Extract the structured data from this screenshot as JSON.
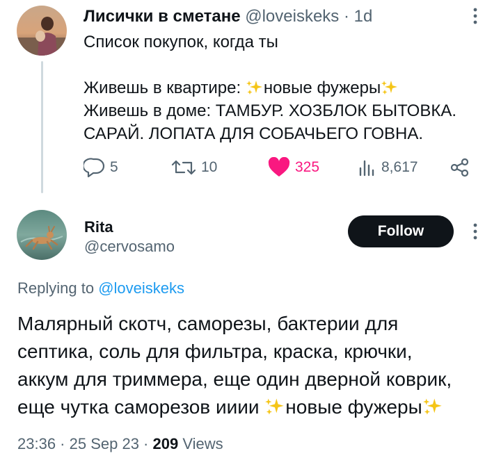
{
  "parent_tweet": {
    "author_name": "Лисички в сметане",
    "handle": "@loveiskeks",
    "separator": "·",
    "time": "1d",
    "text_lines": [
      "Список покупок, когда ты",
      "",
      "Живешь в квартире: ",
      "новые фужеры",
      "Живешь в доме: ТАМБУР. ХОЗБЛОК БЫТОВКА.",
      "САРАЙ. ЛОПАТА ДЛЯ СОБАЧЬЕГО ГОВНА."
    ],
    "actions": {
      "replies": "5",
      "retweets": "10",
      "likes": "325",
      "views": "8,617"
    },
    "icons": [
      "more-icon",
      "reply-icon",
      "retweet-icon",
      "heart-icon",
      "views-icon",
      "share-icon",
      "sparkles-icon"
    ],
    "like_color": "#f91880"
  },
  "main_tweet": {
    "author_name": "Rita",
    "handle": "@cervosamo",
    "follow_label": "Follow",
    "replying_prefix": "Replying to ",
    "replying_handle": "@loveiskeks",
    "text_lines": [
      "Малярный скотч, саморезы, бактерии для",
      "септика,  соль для фильтра, краска, крючки,",
      "аккум для триммера, еще один дверной коврик,",
      "еще чутка саморезов ииии ",
      "новые фужеры"
    ],
    "meta": {
      "time": "23:36",
      "separator": " · ",
      "date": "25 Sep 23",
      "views_count": "209",
      "views_label": " Views"
    }
  },
  "colors": {
    "text": "#0f1419",
    "muted": "#536471",
    "link": "#1d9bf0",
    "button_bg": "#0f1419",
    "sparkle": "#f5c518"
  }
}
